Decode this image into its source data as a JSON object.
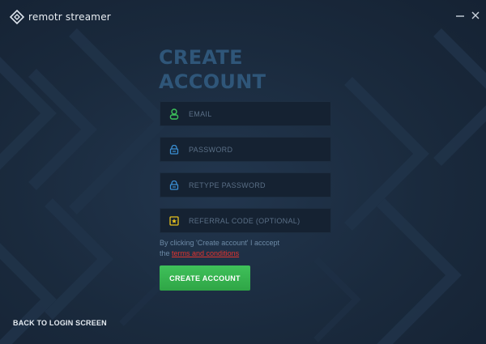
{
  "app": {
    "name": "remotr streamer"
  },
  "window_controls": {
    "minimize_icon": "minus-icon",
    "close_icon": "close-icon"
  },
  "form": {
    "heading_line1": "CREATE",
    "heading_line2": "ACCOUNT",
    "fields": {
      "email": {
        "placeholder": "EMAIL",
        "value": "",
        "icon": "user-icon",
        "icon_color": "#3cc35a"
      },
      "password": {
        "placeholder": "PASSWORD",
        "value": "",
        "icon": "lock-icon",
        "icon_color": "#3a8fd4"
      },
      "retype_password": {
        "placeholder": "RETYPE PASSWORD",
        "value": "",
        "icon": "lock-icon",
        "icon_color": "#3a8fd4"
      },
      "referral": {
        "placeholder": "REFERRAL CODE (OPTIONAL)",
        "value": "",
        "icon": "star-badge-icon",
        "icon_color": "#e8c21e"
      }
    },
    "terms_text_line1": "By clicking 'Create account' I acccept",
    "terms_text_prefix": "the",
    "terms_link": "terms and conditions",
    "submit_label": "CREATE ACCOUNT"
  },
  "footer": {
    "back_link": "BACK TO LOGIN SCREEN"
  },
  "colors": {
    "background": "#1b2a3d",
    "heading": "#2f5679",
    "accent_green": "#3cc35a",
    "link_red": "#e3342f"
  }
}
